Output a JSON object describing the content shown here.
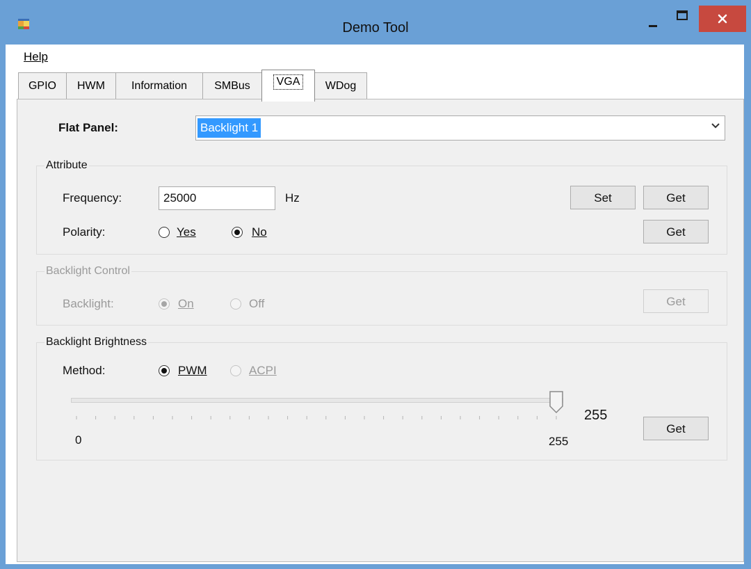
{
  "window": {
    "title": "Demo Tool",
    "title_bar_color": "#6aa0d6",
    "close_button_color": "#c7493f"
  },
  "menu": {
    "help_label": "Help"
  },
  "tabs": [
    {
      "label": "GPIO"
    },
    {
      "label": "HWM"
    },
    {
      "label": "Information"
    },
    {
      "label": "SMBus"
    },
    {
      "label": "VGA",
      "active": true
    },
    {
      "label": "WDog"
    }
  ],
  "flat_panel": {
    "label": "Flat Panel:",
    "selected": "Backlight 1"
  },
  "attribute": {
    "legend": "Attribute",
    "frequency_label": "Frequency:",
    "frequency_value": "25000",
    "frequency_unit": "Hz",
    "set_label": "Set",
    "get_label": "Get",
    "polarity_label": "Polarity:",
    "polarity_yes": "Yes",
    "polarity_no": "No",
    "polarity_selected": "No",
    "polarity_get_label": "Get"
  },
  "backlight_control": {
    "legend": "Backlight Control",
    "backlight_label": "Backlight:",
    "on_label": "On",
    "off_label": "Off",
    "selected": "On",
    "get_label": "Get",
    "enabled": false
  },
  "backlight_brightness": {
    "legend": "Backlight Brightness",
    "method_label": "Method:",
    "pwm_label": "PWM",
    "acpi_label": "ACPI",
    "selected": "PWM",
    "slider_min": "0",
    "slider_max": "255",
    "slider_value": 255,
    "value_display": "255",
    "get_label": "Get"
  }
}
